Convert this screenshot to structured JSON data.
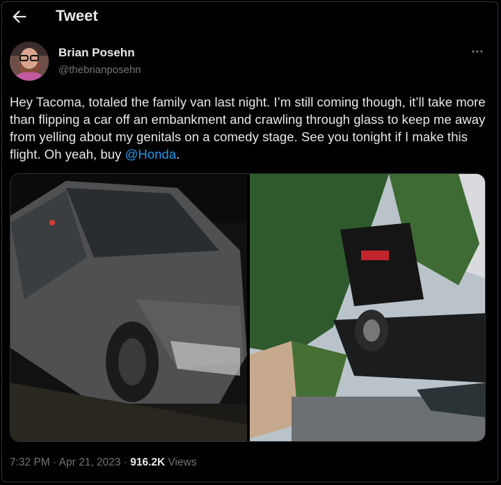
{
  "header": {
    "title": "Tweet"
  },
  "author": {
    "display_name": "Brian Posehn",
    "handle": "@thebrianposehn"
  },
  "tweet": {
    "text_before_mention": "Hey Tacoma, totaled the family van last night. I’m still coming though, it’ll take more than flipping a car off an embankment and crawling through glass to keep me away from yelling about my genitals on a comedy stage. See you tonight if I make this flight. Oh yeah, buy ",
    "mention": "@Honda",
    "text_after_mention": "."
  },
  "meta": {
    "time": "7:32 PM",
    "separator": " · ",
    "date": "Apr 21, 2023",
    "views_count": "916.2K",
    "views_label": "Views"
  },
  "icons": {
    "back": "arrow-left-icon",
    "more": "more-horizontal-icon"
  },
  "colors": {
    "background": "#000000",
    "text": "#e7e9ea",
    "secondary": "#71767b",
    "link": "#1d9bf0"
  }
}
